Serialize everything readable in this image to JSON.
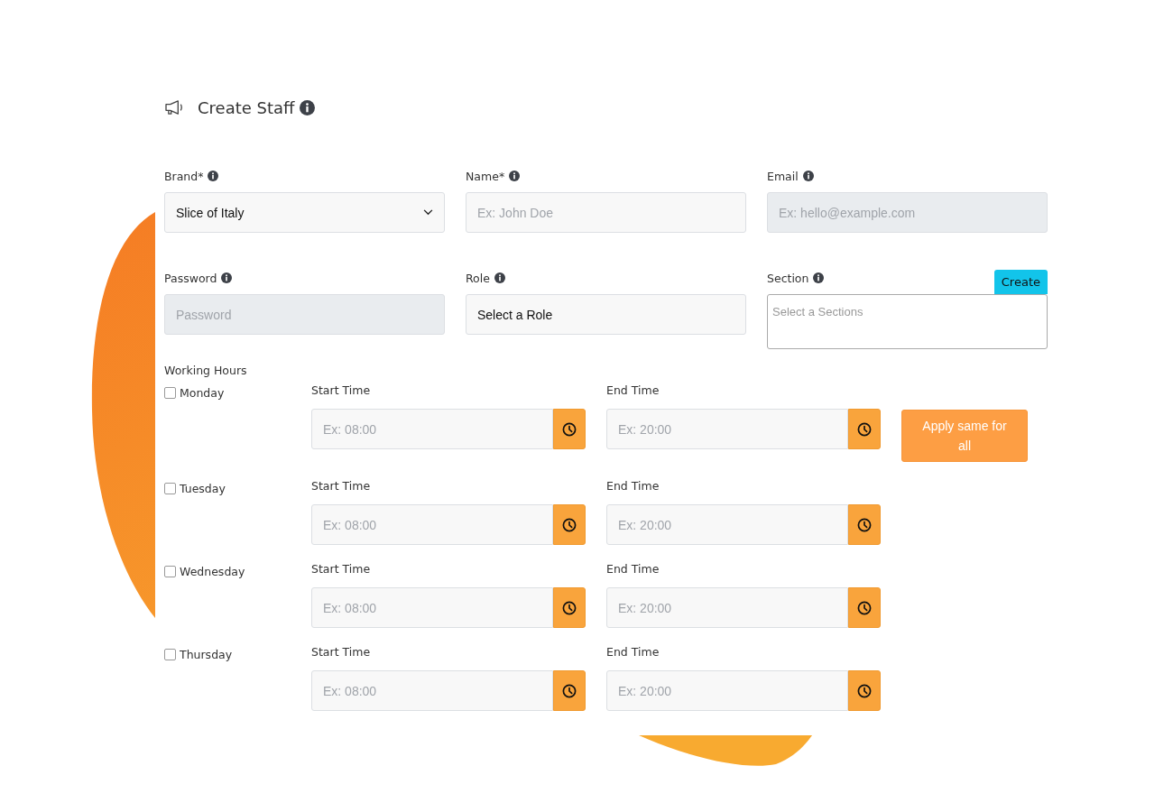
{
  "title": "Create Staff",
  "fields": [
    {
      "label": "Brand*",
      "kind": "select",
      "value": "Slice of Italy",
      "disabled": false
    },
    {
      "label": "Name*",
      "kind": "text",
      "placeholder": "Ex: John Doe",
      "disabled": false
    },
    {
      "label": "Email",
      "kind": "text",
      "placeholder": "Ex: hello@example.com",
      "disabled": true
    },
    {
      "label": "Password",
      "kind": "text",
      "placeholder": "Password",
      "disabled": true
    },
    {
      "label": "Role",
      "kind": "picker",
      "value": "Select a Role",
      "disabled": false
    },
    {
      "label": "Section",
      "kind": "multiselect",
      "placeholder": "Select a Sections",
      "action": "Create",
      "disabled": false
    }
  ],
  "working_hours": {
    "title": "Working Hours",
    "apply_button": "Apply same for all",
    "days": [
      {
        "label": "Monday",
        "checked": false,
        "start_label": "Start Time",
        "start_placeholder": "Ex: 08:00",
        "end_label": "End Time",
        "end_placeholder": "Ex: 20:00"
      },
      {
        "label": "Tuesday",
        "checked": false,
        "start_label": "Start Time",
        "start_placeholder": "Ex: 08:00",
        "end_label": "End Time",
        "end_placeholder": "Ex: 20:00"
      },
      {
        "label": "Wednesday",
        "checked": false,
        "start_label": "Start Time",
        "start_placeholder": "Ex: 08:00",
        "end_label": "End Time",
        "end_placeholder": "Ex: 20:00"
      },
      {
        "label": "Thursday",
        "checked": false,
        "start_label": "Start Time",
        "start_placeholder": "Ex: 08:00",
        "end_label": "End Time",
        "end_placeholder": "Ex: 20:00"
      }
    ]
  }
}
